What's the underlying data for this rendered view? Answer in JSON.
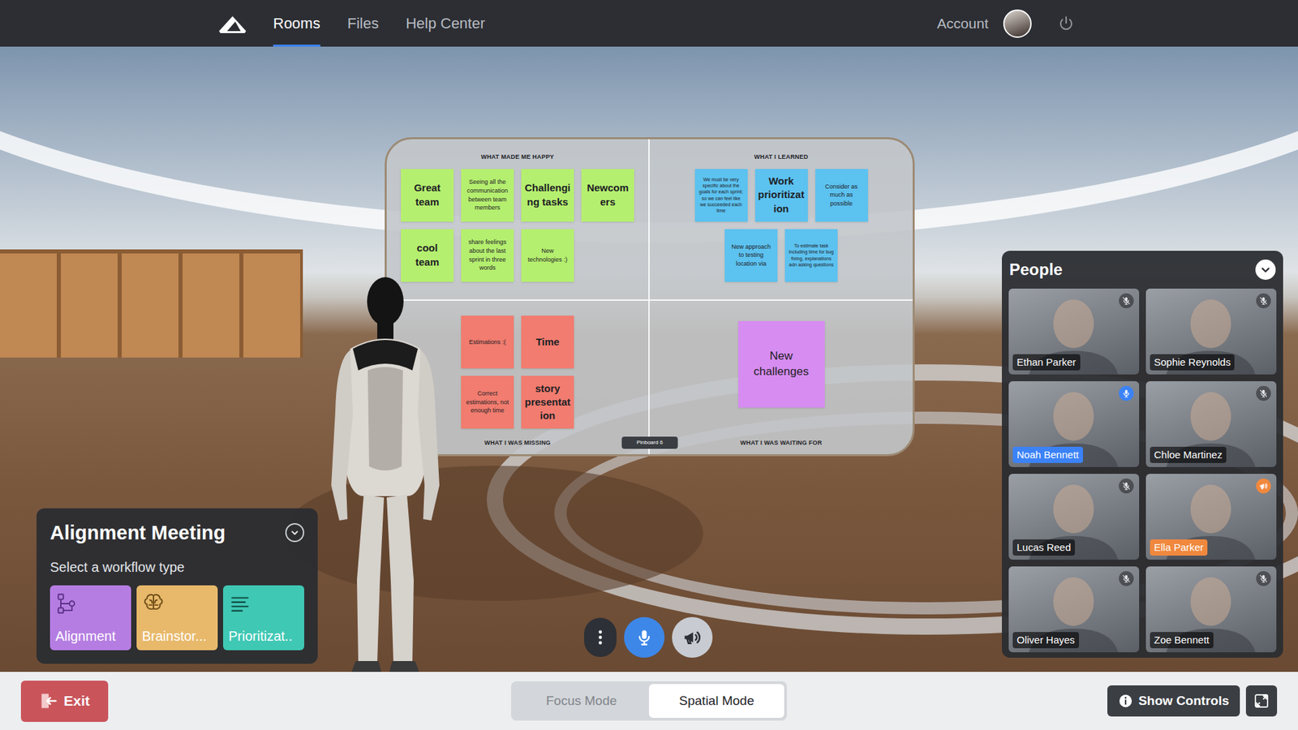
{
  "nav": {
    "tabs": [
      {
        "label": "Rooms",
        "selected": true
      },
      {
        "label": "Files",
        "selected": false
      },
      {
        "label": "Help Center",
        "selected": false
      }
    ],
    "account": "Account"
  },
  "pinboard": {
    "label": "Pinboard 6",
    "quadrants": [
      {
        "title": "WHAT MADE ME HAPPY",
        "color": "#b5ef6f",
        "notes": [
          {
            "text": "Great team",
            "kind": "big"
          },
          {
            "text": "Seeing all the communication between team members",
            "kind": "small"
          },
          {
            "text": "Challenging tasks",
            "kind": "big"
          },
          {
            "text": "Newcomers",
            "kind": "big"
          },
          {
            "text": "cool team",
            "kind": "big"
          },
          {
            "text": "share feelings about the last sprint in three words",
            "kind": "small"
          },
          {
            "text": "New technologies :)",
            "kind": "small"
          }
        ]
      },
      {
        "title": "WHAT I LEARNED",
        "color": "#5cc2f0",
        "notes": [
          {
            "text": "We must be very specific about the goals for each sprint; so we can feel like we succeeded each time",
            "kind": "tiny"
          },
          {
            "text": "Work prioritization",
            "kind": "big"
          },
          {
            "text": "Consider as much as possible",
            "kind": "small"
          },
          {
            "text": "New approach to testing location via",
            "kind": "small"
          },
          {
            "text": "To estimate task including time for bug fixing, explanations adn asking questions",
            "kind": "tiny"
          }
        ]
      },
      {
        "title": "WHAT I WAS MISSING",
        "color": "#f17c6f",
        "notes": [
          {
            "text": "Estimations :(",
            "kind": "small"
          },
          {
            "text": "Time",
            "kind": "big"
          },
          {
            "text": "Correct estimations, not enough time",
            "kind": "small"
          },
          {
            "text": "story presentation",
            "kind": "big"
          }
        ]
      },
      {
        "title": "WHAT I WAS WAITING FOR",
        "color": "#d68cf0",
        "notes": [
          {
            "text": "New challenges",
            "kind": "large"
          }
        ]
      }
    ]
  },
  "meeting": {
    "title": "Alignment Meeting",
    "expanded": true,
    "prompt": "Select a workflow type",
    "workflows": [
      {
        "label": "Alignment",
        "kind": "alignment",
        "color": "#b57de2"
      },
      {
        "label": "Brainstor...",
        "kind": "brainstorm",
        "color": "#e8b96b"
      },
      {
        "label": "Prioritizat..",
        "kind": "prioritization",
        "color": "#3fc8b4"
      }
    ]
  },
  "controls": [
    {
      "kind": "more",
      "active": false
    },
    {
      "kind": "mic",
      "active": true
    },
    {
      "kind": "megaphone",
      "active": false
    }
  ],
  "people": {
    "title": "People",
    "expanded": true,
    "participants": [
      {
        "name": "Ethan Parker",
        "status": "muted"
      },
      {
        "name": "Sophie Reynolds",
        "status": "muted"
      },
      {
        "name": "Noah Bennett",
        "status": "speaking"
      },
      {
        "name": "Chloe Martinez",
        "status": "muted"
      },
      {
        "name": "Lucas Reed",
        "status": "muted"
      },
      {
        "name": "Ella Parker",
        "status": "presenting"
      },
      {
        "name": "Oliver Hayes",
        "status": "muted"
      },
      {
        "name": "Zoe Bennett",
        "status": "muted"
      }
    ]
  },
  "footer": {
    "exit": "Exit",
    "modes": [
      {
        "label": "Focus Mode",
        "selected": false
      },
      {
        "label": "Spatial Mode",
        "selected": true
      }
    ],
    "show_controls": "Show Controls"
  }
}
